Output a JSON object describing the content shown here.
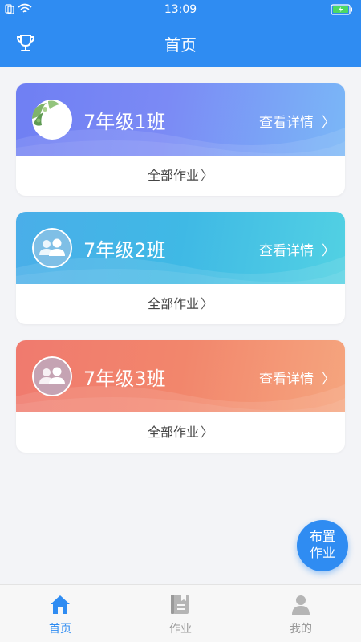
{
  "status": {
    "time": "13:09"
  },
  "header": {
    "title": "首页"
  },
  "classes": [
    {
      "name": "7年级1班",
      "detail": "查看详情",
      "homework": "全部作业"
    },
    {
      "name": "7年级2班",
      "detail": "查看详情",
      "homework": "全部作业"
    },
    {
      "name": "7年级3班",
      "detail": "查看详情",
      "homework": "全部作业"
    }
  ],
  "fab": {
    "line1": "布置",
    "line2": "作业"
  },
  "tabs": [
    {
      "label": "首页",
      "icon": "home-icon",
      "active": true
    },
    {
      "label": "作业",
      "icon": "book-icon",
      "active": false
    },
    {
      "label": "我的",
      "icon": "person-icon",
      "active": false
    }
  ],
  "colors": {
    "primary": "#2f8cf2",
    "card1": "#7b8af5",
    "card2": "#3fb9e5",
    "card3": "#f2866c",
    "tab_inactive": "#9a9a9a"
  },
  "icons": {
    "header_left": "trophy-icon",
    "card_chevron": "chevron-right-icon",
    "group_avatar": "group-avatar-icon",
    "photo_avatar": "plant-avatar"
  }
}
